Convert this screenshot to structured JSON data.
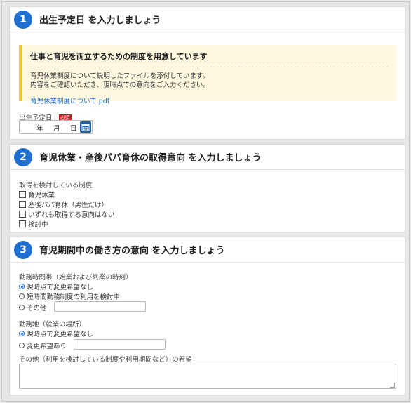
{
  "section1": {
    "number": "1",
    "title": "出生予定日 を入力しましょう",
    "notice": {
      "title": "仕事と育児を両立するための制度を用意しています",
      "line1": "育児休業制度について説明したファイルを添付しています。",
      "line2": "内容をご確認いただき、現時点での意向をご入力ください。",
      "link": "育児休業制度について.pdf"
    },
    "birthdate_label": "出生予定日",
    "required_badge": "必須",
    "date": {
      "year": "年",
      "month": "月",
      "day": "日"
    },
    "calendar_icon": "calendar-icon"
  },
  "section2": {
    "number": "2",
    "title": "育児休業・産後パパ育休の取得意向 を入力しましょう",
    "label": "取得を検討している制度",
    "options": [
      "育児休業",
      "産後パパ育休（男性だけ）",
      "いずれも取得する意向はない",
      "検討中"
    ]
  },
  "section3": {
    "number": "3",
    "title": "育児期間中の働き方の意向 を入力しましょう",
    "hours_label": "勤務時間帯（始業および終業の時刻）",
    "hours_options": [
      "現時点で変更希望なし",
      "短時間勤務制度の利用を検討中",
      "その他"
    ],
    "place_label": "勤務地（就業の場所）",
    "place_options": [
      "現時点で変更希望なし",
      "変更希望あり"
    ],
    "other_label": "その他（利用を検討している制度や利用期間など）の希望"
  },
  "colors": {
    "accent": "#1f6fd1",
    "notice_bg": "#fff7df",
    "notice_border": "#f0c343",
    "required": "#d9131e"
  }
}
